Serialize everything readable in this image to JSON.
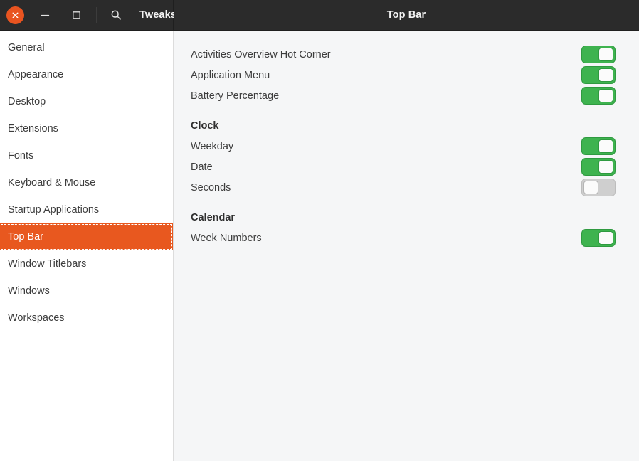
{
  "window": {
    "app_title": "Tweaks",
    "page_title": "Top Bar",
    "controls": {
      "close_label": "Close",
      "minimize_label": "Minimize",
      "maximize_label": "Maximize",
      "search_label": "Search"
    },
    "colors": {
      "headerbar_bg": "#2b2b2b",
      "close_button": "#e95420",
      "selection": "#e8581f",
      "switch_on": "#3eb34f",
      "switch_off": "#cfcfcf",
      "sidebar_bg": "#ffffff",
      "content_bg": "#f5f6f7"
    }
  },
  "sidebar": {
    "items": [
      {
        "label": "General",
        "selected": false
      },
      {
        "label": "Appearance",
        "selected": false
      },
      {
        "label": "Desktop",
        "selected": false
      },
      {
        "label": "Extensions",
        "selected": false
      },
      {
        "label": "Fonts",
        "selected": false
      },
      {
        "label": "Keyboard & Mouse",
        "selected": false
      },
      {
        "label": "Startup Applications",
        "selected": false
      },
      {
        "label": "Top Bar",
        "selected": true
      },
      {
        "label": "Window Titlebars",
        "selected": false
      },
      {
        "label": "Windows",
        "selected": false
      },
      {
        "label": "Workspaces",
        "selected": false
      }
    ]
  },
  "main": {
    "groups": [
      {
        "heading": null,
        "rows": [
          {
            "label": "Activities Overview Hot Corner",
            "state": "on"
          },
          {
            "label": "Application Menu",
            "state": "on"
          },
          {
            "label": "Battery Percentage",
            "state": "on"
          }
        ]
      },
      {
        "heading": "Clock",
        "rows": [
          {
            "label": "Weekday",
            "state": "on"
          },
          {
            "label": "Date",
            "state": "on"
          },
          {
            "label": "Seconds",
            "state": "off"
          }
        ]
      },
      {
        "heading": "Calendar",
        "rows": [
          {
            "label": "Week Numbers",
            "state": "on"
          }
        ]
      }
    ]
  }
}
